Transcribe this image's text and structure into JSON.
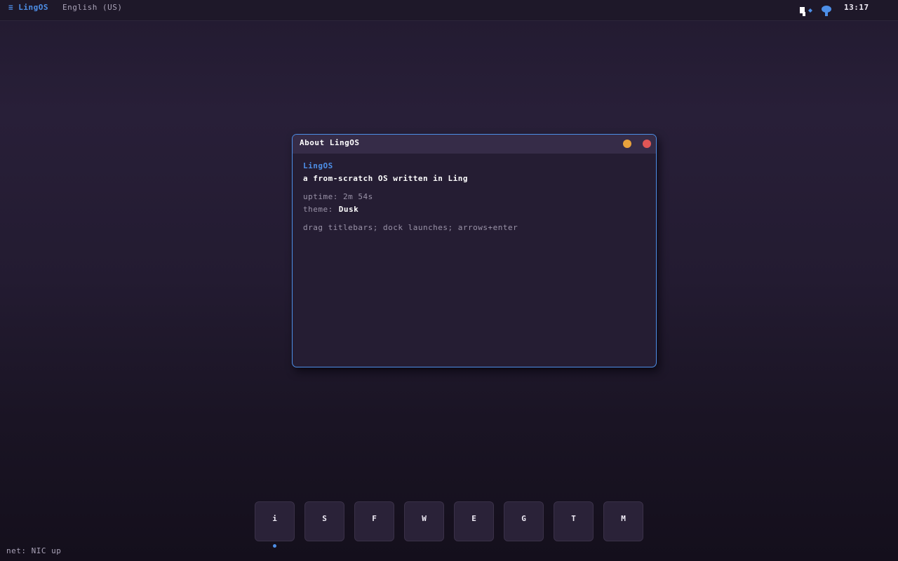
{
  "topbar": {
    "menu_label": "≡ LingOS",
    "language": "English (US)",
    "clock": "13:17",
    "tray_icons": [
      "network-icon",
      "volume-icon"
    ]
  },
  "window": {
    "title": "About LingOS",
    "app_name": "LingOS",
    "tagline": "a from-scratch OS written in Ling",
    "uptime": "uptime: 2m 54s",
    "theme_label": "theme:",
    "theme_value": "Dusk",
    "hint": "drag titlebars; dock launches; arrows+enter"
  },
  "dock": {
    "items": [
      {
        "label": "i",
        "active": true
      },
      {
        "label": "S",
        "active": false
      },
      {
        "label": "F",
        "active": false
      },
      {
        "label": "W",
        "active": false
      },
      {
        "label": "E",
        "active": false
      },
      {
        "label": "G",
        "active": false
      },
      {
        "label": "T",
        "active": false
      },
      {
        "label": "M",
        "active": false
      }
    ]
  },
  "status": "net: NIC up",
  "colors": {
    "accent": "#4d8fe8",
    "minimize": "#e8a23c",
    "close": "#e05656"
  }
}
